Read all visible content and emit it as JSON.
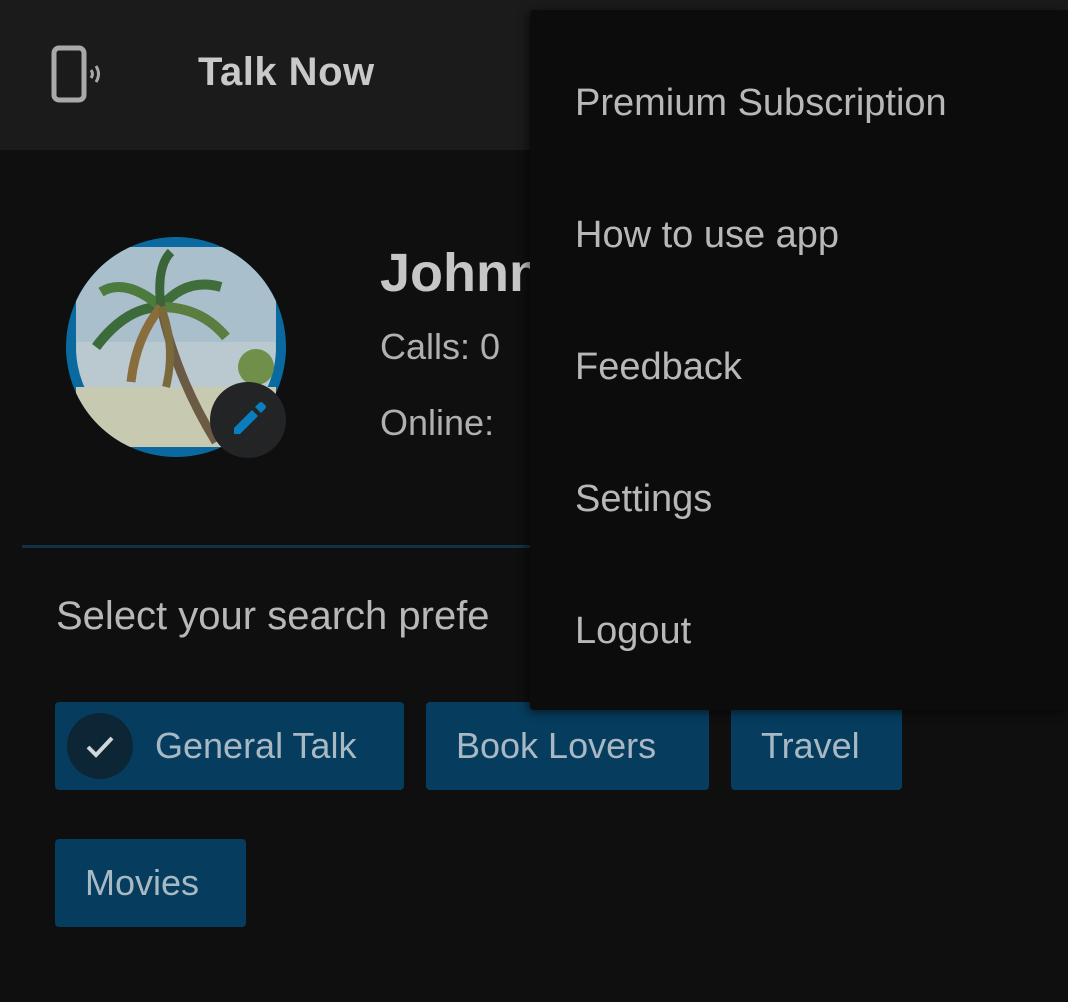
{
  "app": {
    "title": "Talk Now",
    "icon": "phone-vibrate-icon"
  },
  "profile": {
    "name": "Johnn",
    "calls": "Calls: 0",
    "online": "Online:",
    "avatar_icon": "profile-avatar",
    "edit_icon": "pencil-icon"
  },
  "preferences": {
    "label": "Select your search prefe",
    "chips": [
      {
        "label": "General Talk",
        "selected": true
      },
      {
        "label": "Book Lovers",
        "selected": false
      },
      {
        "label": "Travel",
        "selected": false
      },
      {
        "label": "Movies",
        "selected": false
      }
    ]
  },
  "menu": {
    "items": [
      {
        "label": "Premium Subscription"
      },
      {
        "label": "How to use app"
      },
      {
        "label": "Feedback"
      },
      {
        "label": "Settings"
      },
      {
        "label": "Logout"
      }
    ]
  },
  "colors": {
    "background": "#0f0f0f",
    "appbar": "#1b1b1b",
    "accent": "#0a6aa0",
    "chip": "#063d5e",
    "menu": "#0c0c0c"
  }
}
